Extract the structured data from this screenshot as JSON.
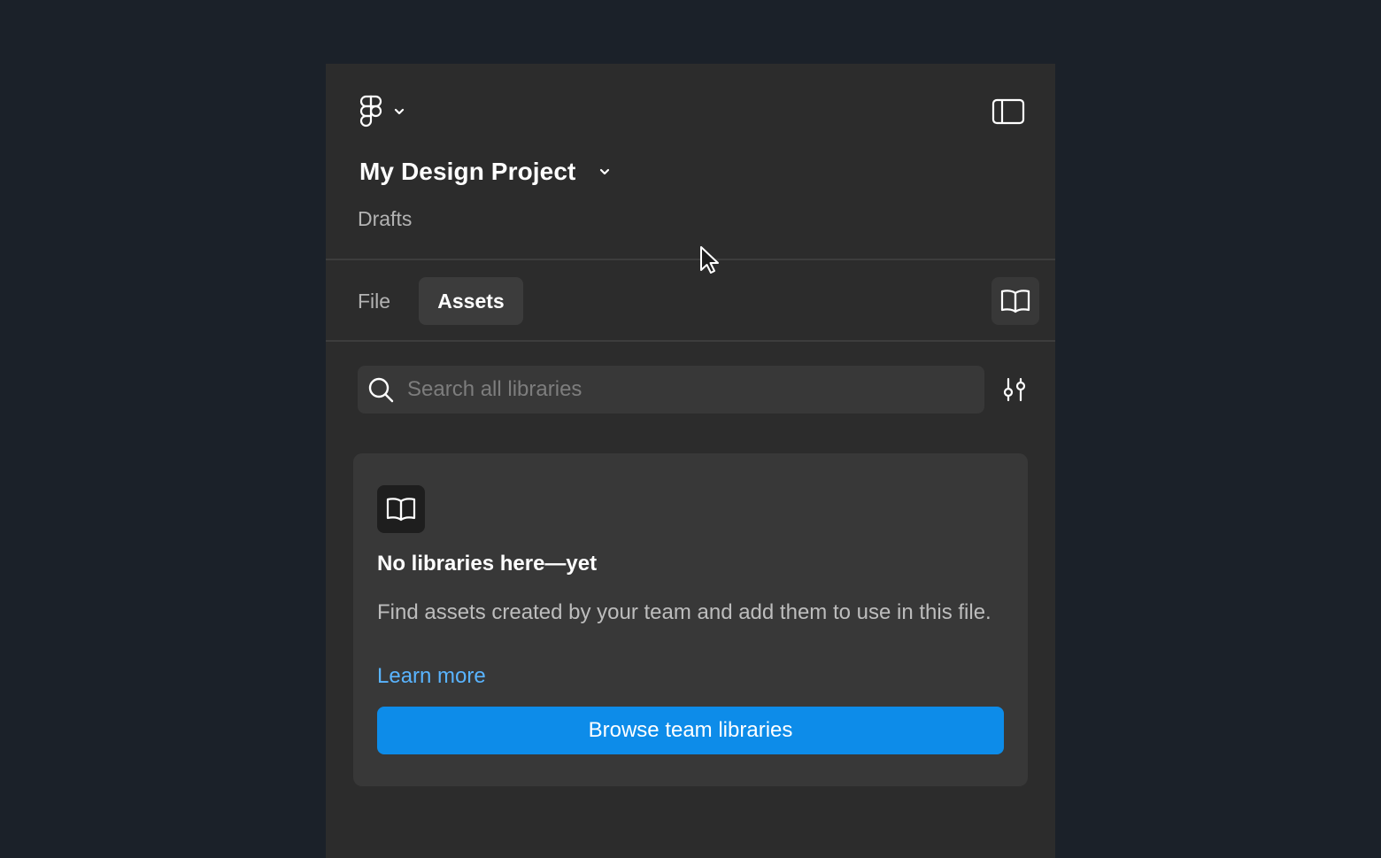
{
  "app": {
    "logo_icon": "figma-logo-icon",
    "menu_icon": "chevron-down-icon",
    "sidebar_toggle_icon": "sidebar-panel-icon"
  },
  "project": {
    "title": "My Design Project",
    "location": "Drafts",
    "menu_icon": "chevron-down-icon"
  },
  "tabs": [
    {
      "label": "File",
      "active": false
    },
    {
      "label": "Assets",
      "active": true
    }
  ],
  "toolbar": {
    "library_icon": "book-open-icon"
  },
  "search": {
    "placeholder": "Search all libraries",
    "value": "",
    "icon": "search-icon",
    "filter_icon": "sliders-icon"
  },
  "empty_state": {
    "icon": "book-open-icon",
    "title": "No libraries here—yet",
    "description": "Find assets created by your team and add them to use in this file.",
    "link_label": "Learn more",
    "button_label": "Browse team libraries"
  },
  "colors": {
    "page_background": "#1b2129",
    "panel_background": "#2c2c2c",
    "card_background": "#383838",
    "accent": "#0d8ce9",
    "link": "#59b4ff"
  }
}
